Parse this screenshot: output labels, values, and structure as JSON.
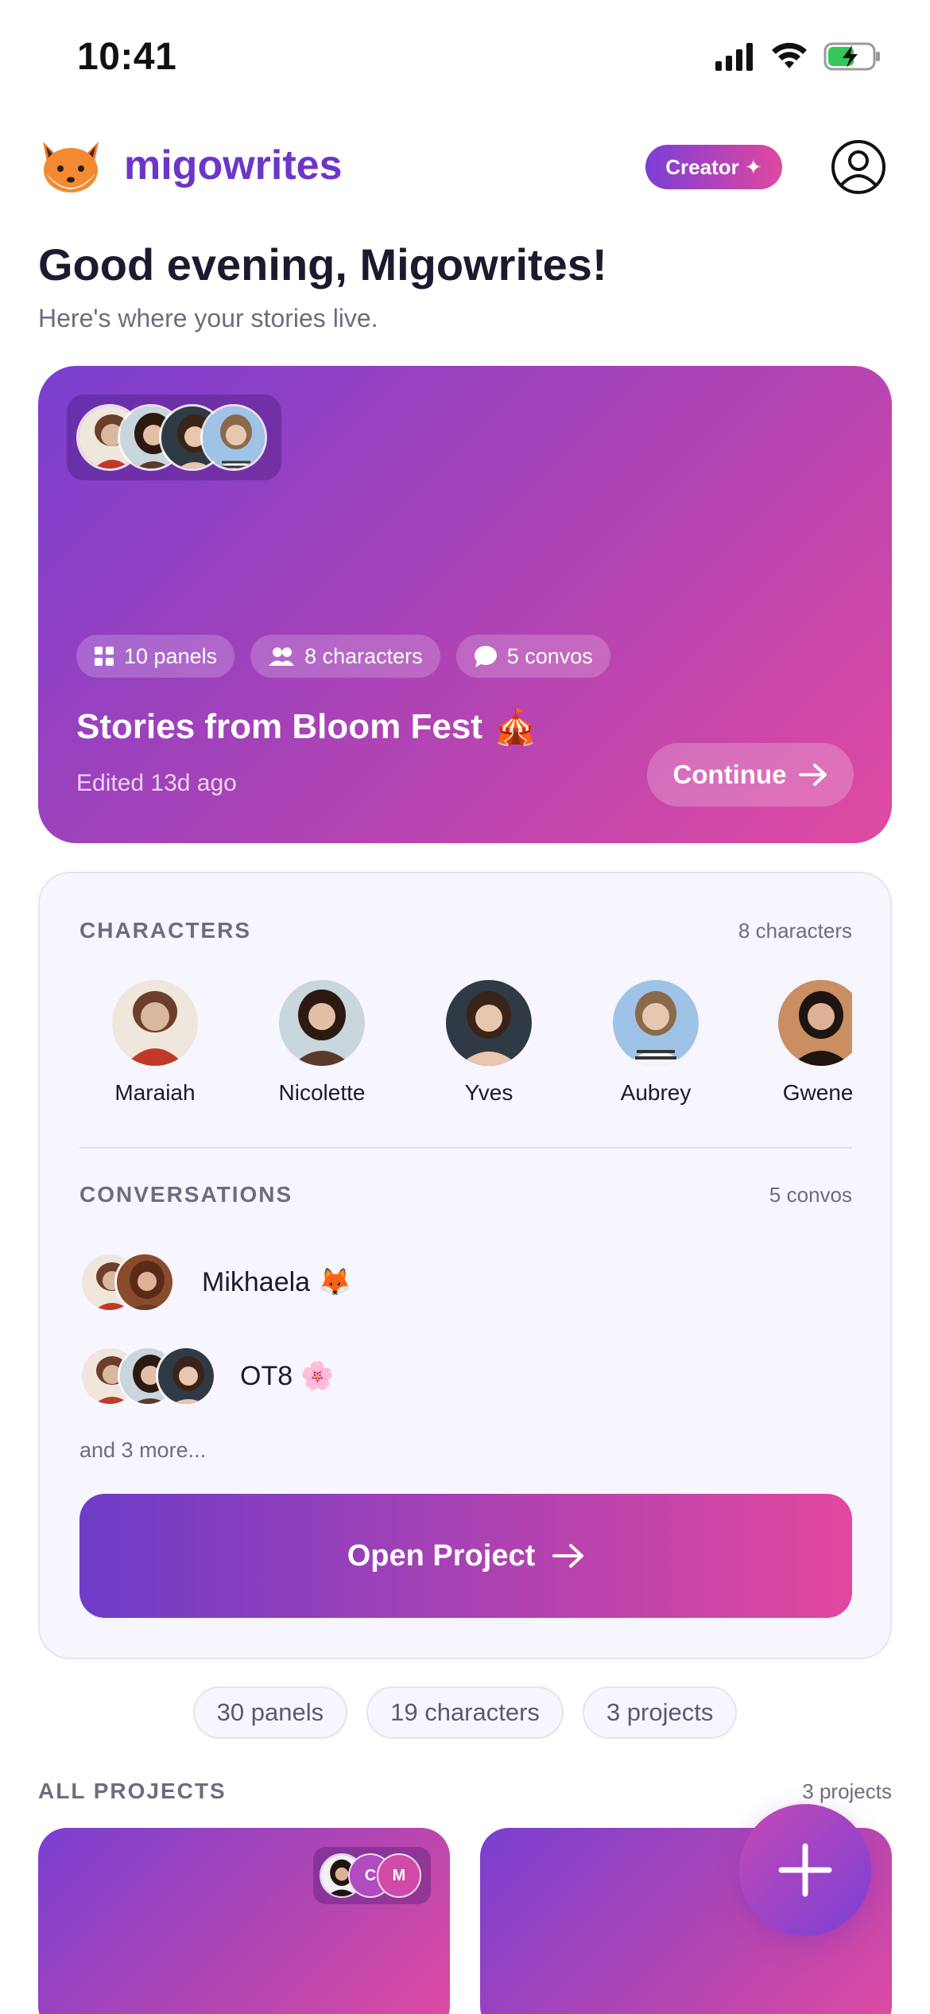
{
  "status_bar": {
    "time": "10:41"
  },
  "header": {
    "brand": "migowrites",
    "badge_label": "Creator ✦"
  },
  "greeting": {
    "title": "Good evening, Migowrites!",
    "subtitle": "Here's where your stories live."
  },
  "hero": {
    "chips": [
      {
        "icon": "grid-icon",
        "label": "10 panels"
      },
      {
        "icon": "people-icon",
        "label": "8 characters"
      },
      {
        "icon": "chat-bubble-icon",
        "label": "5 convos"
      }
    ],
    "title": "Stories from Bloom Fest",
    "title_emoji": "🎪",
    "edited": "Edited 13d ago",
    "continue_label": "Continue"
  },
  "characters": {
    "label": "CHARACTERS",
    "count": "8 characters",
    "items": [
      {
        "name": "Maraiah",
        "tone": "#d9b7a0",
        "hair": "#6b3f2a",
        "bg": "#efe6dc"
      },
      {
        "name": "Nicolette",
        "tone": "#e2bfa6",
        "hair": "#2c1a12",
        "bg": "#c9d6de"
      },
      {
        "name": "Yves",
        "tone": "#e9c6ae",
        "hair": "#3a2419",
        "bg": "#2f3a45"
      },
      {
        "name": "Aubrey",
        "tone": "#e6c8b2",
        "hair": "#8a6a4a",
        "bg": "#9fc3e6"
      },
      {
        "name": "Gwenet",
        "tone": "#dcb196",
        "hair": "#1e1410",
        "bg": "#c98e62"
      }
    ]
  },
  "conversations": {
    "label": "CONVERSATIONS",
    "count": "5 convos",
    "items": [
      {
        "name": "Mikhaela",
        "emoji": "🦊"
      },
      {
        "name": "OT8",
        "emoji": "🌸"
      }
    ],
    "more": "and 3 more..."
  },
  "open_project_label": "Open Project",
  "stats": [
    "30 panels",
    "19 characters",
    "3 projects"
  ],
  "all_projects": {
    "label": "ALL PROJECTS",
    "count": "3 projects",
    "card_avatar_letters": [
      "C",
      "M"
    ]
  },
  "colors": {
    "brand": "#6d35c9",
    "gradient_start": "#7a3fd0",
    "gradient_end": "#e04aa2",
    "muted_text": "#6f6b80"
  }
}
